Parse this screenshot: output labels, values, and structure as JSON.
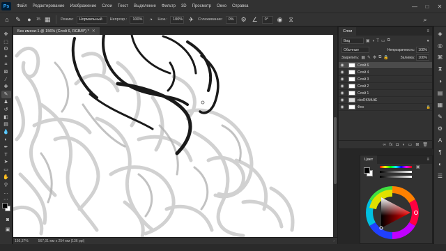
{
  "app": {
    "logo": "Ps"
  },
  "menu": [
    "Файл",
    "Редактирование",
    "Изображение",
    "Слои",
    "Текст",
    "Выделение",
    "Фильтр",
    "3D",
    "Просмотр",
    "Окно",
    "Справка"
  ],
  "window_controls": {
    "minimize": "—",
    "maximize": "□",
    "close": "✕"
  },
  "options": {
    "brush_size": "15",
    "mode_label": "Режим:",
    "mode_value": "Нормальный",
    "opacity_label": "Непрозр.:",
    "opacity_value": "100%",
    "flow_label": "Наж.:",
    "flow_value": "100%",
    "smoothing_label": "Сглаживание:",
    "smoothing_value": "0%",
    "angle_value": "0°"
  },
  "document": {
    "tab_title": "Без имени-1 @ 156% (Слой 6, RGB/8*) *",
    "tab_close": "✕",
    "zoom": "156,37%",
    "doc_info": "567,01 мм x 254 мм (136 ppi)"
  },
  "layers_panel": {
    "tab": "Слои",
    "kind_filter": "Вид",
    "blend_mode": "Обычные",
    "opacity_label": "Непрозрачность:",
    "opacity_value": "100%",
    "lock_label": "Закрепить:",
    "fill_label": "Заливка:",
    "fill_value": "100%",
    "layers": [
      {
        "name": "Слой 6",
        "selected": true
      },
      {
        "name": "Слой 4",
        "selected": false
      },
      {
        "name": "Слой 3",
        "selected": false
      },
      {
        "name": "Слой 2",
        "selected": false
      },
      {
        "name": "Слой 1",
        "selected": false
      },
      {
        "name": "okoRKNtUtE",
        "selected": false
      },
      {
        "name": "Фон",
        "selected": false
      }
    ]
  },
  "color_panel": {
    "tab": "Цвет"
  },
  "colors": {
    "accent": "#31a8ff",
    "selected_layer": "#4b4b4b",
    "panel": "#323232"
  }
}
